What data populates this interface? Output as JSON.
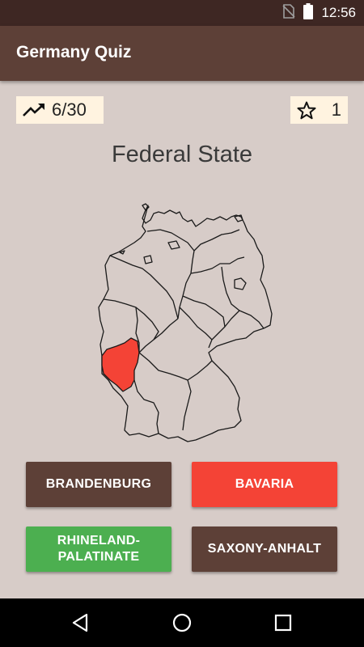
{
  "status_bar": {
    "time": "12:56",
    "icons": [
      "no-sim-icon",
      "battery-icon"
    ]
  },
  "app_bar": {
    "title": "Germany Quiz"
  },
  "progress": {
    "icon": "trending-up-icon",
    "text": "6/30"
  },
  "stars": {
    "icon": "star-outline-icon",
    "text": "1"
  },
  "question": {
    "title": "Federal State"
  },
  "map": {
    "highlighted_region": "Rhineland-Palatinate",
    "highlight_color": "#f44336"
  },
  "answers": [
    {
      "label": "BRANDENBURG",
      "state": "neutral",
      "color": "#5d4037"
    },
    {
      "label": "BAVARIA",
      "state": "wrong",
      "color": "#f44336"
    },
    {
      "label": "RHINELAND-\nPALATINATE",
      "state": "correct",
      "color": "#4caf50"
    },
    {
      "label": "SAXONY-ANHALT",
      "state": "neutral",
      "color": "#5d4037"
    }
  ],
  "colors": {
    "app_bar": "#5d4037",
    "status_bar": "#3e2723",
    "background": "#d7ccc8",
    "chip": "#fff3e0",
    "nav_bar": "#000000"
  },
  "nav_bar": {
    "buttons": [
      "back-icon",
      "home-icon",
      "recents-icon"
    ]
  }
}
